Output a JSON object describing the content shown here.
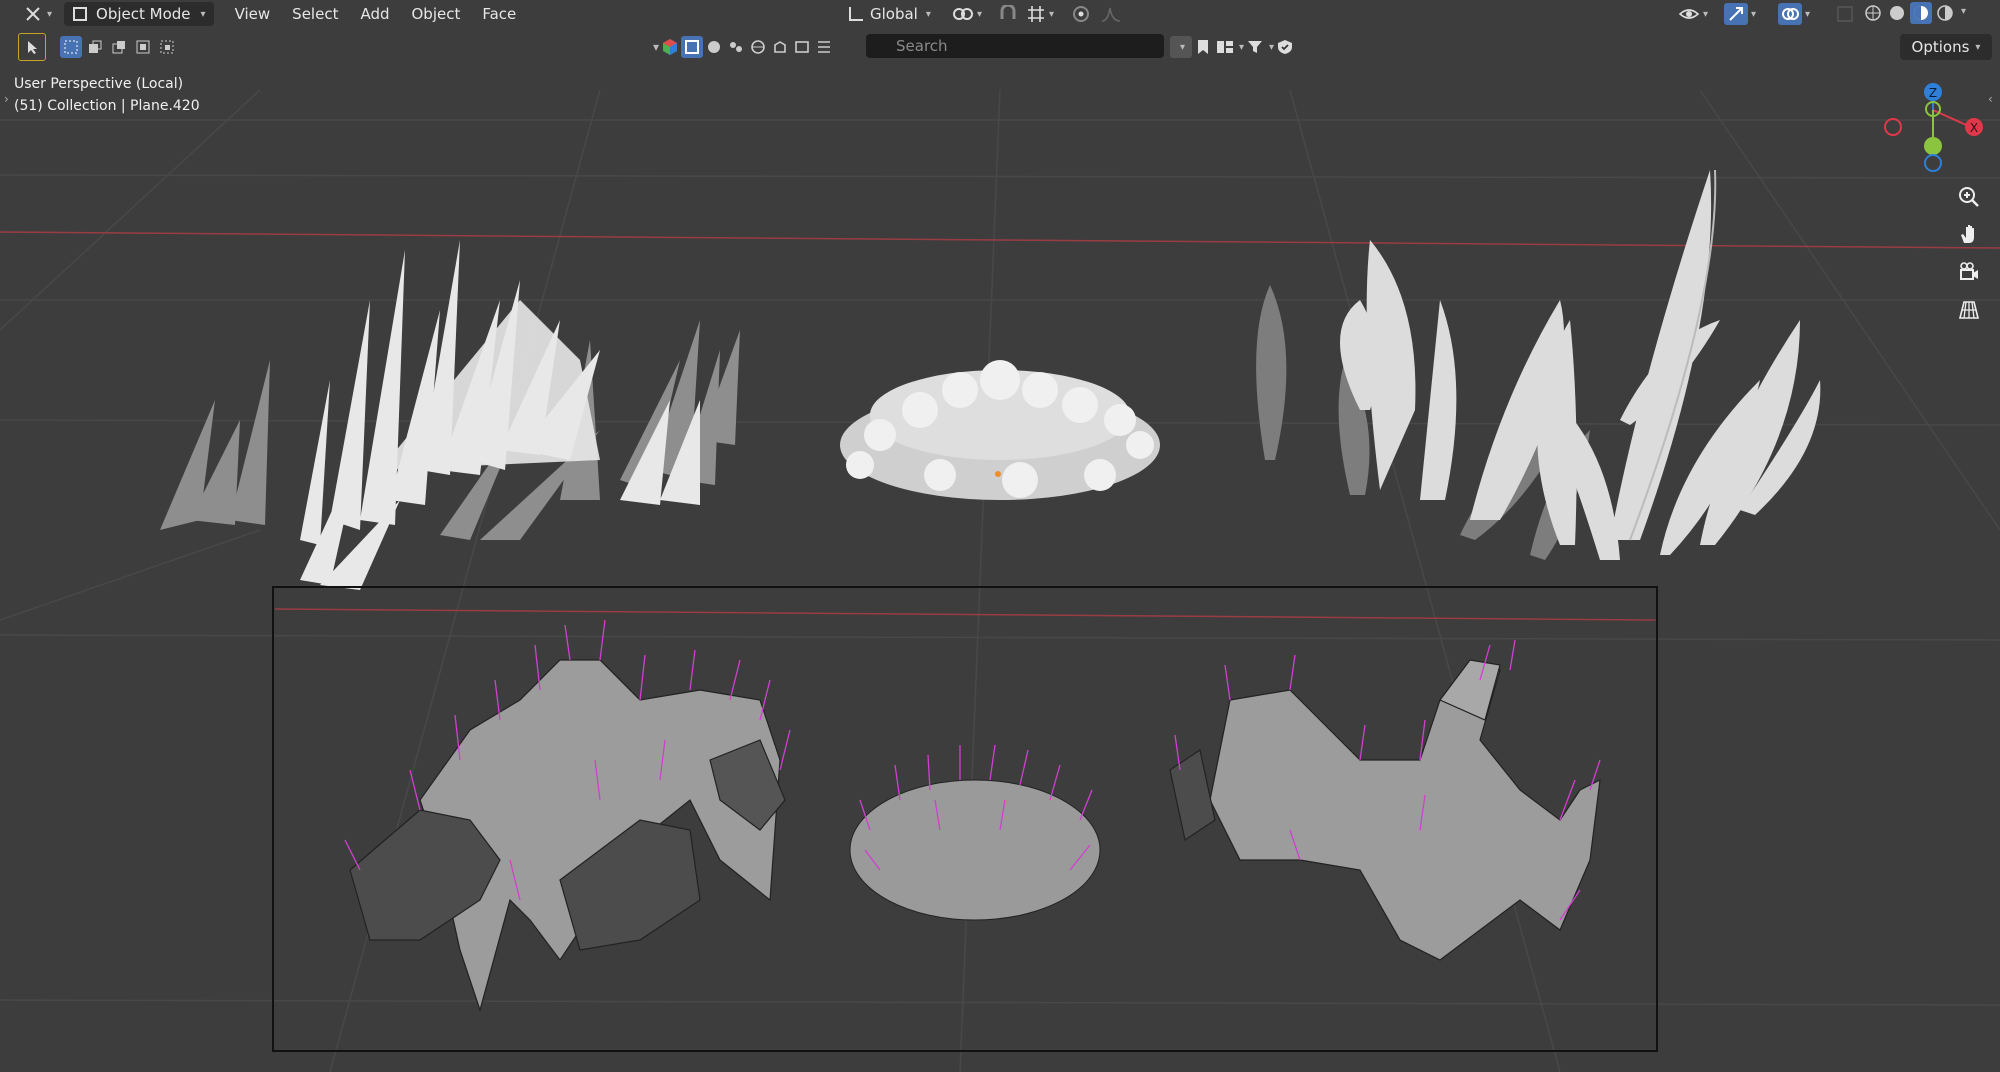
{
  "header": {
    "mode_label": "Object Mode",
    "menus": [
      "View",
      "Select",
      "Add",
      "Object",
      "Face"
    ],
    "transform_orientation": "Global"
  },
  "toolbar": {
    "search_placeholder": "Search",
    "options_label": "Options"
  },
  "viewport": {
    "perspective_label": "User Perspective (Local)",
    "collection_label": "(51) Collection | Plane.420"
  },
  "gizmo": {
    "z_label": "Z",
    "x_label": "X",
    "colors": {
      "x": "#e0384a",
      "y": "#8bc53f",
      "z": "#2e7fd9"
    }
  },
  "icons": [
    "editor-type-icon",
    "object-mode-icon",
    "select-box-icon",
    "transform-orientation-icon",
    "snap-icon",
    "proportional-icon",
    "search-icon",
    "filter-icon",
    "zoom-icon",
    "hand-pan-icon",
    "camera-icon",
    "grid-icon",
    "overlay-icon",
    "shading-icon"
  ]
}
